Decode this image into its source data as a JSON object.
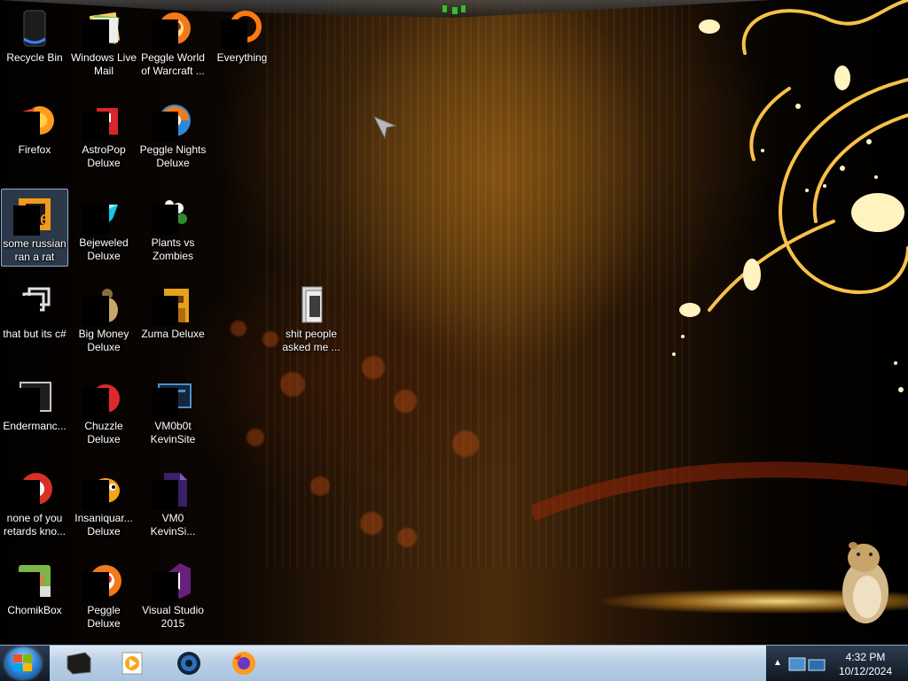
{
  "desktop_icons": [
    {
      "label": "Recycle Bin",
      "icon": "recycle-bin-icon",
      "selected": false
    },
    {
      "label": "Windows Live\nMail",
      "icon": "mail-icon",
      "selected": false
    },
    {
      "label": "Peggle World\nof Warcraft ...",
      "icon": "peggle-wow-icon",
      "selected": false
    },
    {
      "label": "Everything",
      "icon": "everything-search-icon",
      "selected": false
    },
    {
      "label": "Firefox",
      "icon": "firefox-icon",
      "selected": false
    },
    {
      "label": "AstroPop\nDeluxe",
      "icon": "astropop-icon",
      "selected": false
    },
    {
      "label": "Peggle Nights\nDeluxe",
      "icon": "peggle-nights-icon",
      "selected": false
    },
    {
      "label": "some russian\nran a rat",
      "icon": "app-icon",
      "selected": true
    },
    {
      "label": "Bejeweled\nDeluxe",
      "icon": "bejeweled-icon",
      "selected": false
    },
    {
      "label": "Plants vs\nZombies",
      "icon": "plants-vs-zombies-icon",
      "selected": false
    },
    {
      "label": "that but its c#",
      "icon": "shortcut-icon",
      "selected": false
    },
    {
      "label": "Big Money\nDeluxe",
      "icon": "big-money-icon",
      "selected": false
    },
    {
      "label": "Zuma Deluxe",
      "icon": "zuma-icon",
      "selected": false
    },
    {
      "label": "shit people\nasked me ...",
      "icon": "folder-icon",
      "selected": false
    },
    {
      "label": "Endermanc...",
      "icon": "terminal-icon",
      "selected": false
    },
    {
      "label": "Chuzzle\nDeluxe",
      "icon": "chuzzle-icon",
      "selected": false
    },
    {
      "label": "VM0b0t\nKevinSite",
      "icon": "vm-icon",
      "selected": false
    },
    {
      "label": "none of you\nretards kno...",
      "icon": "chrome-like-icon",
      "selected": false
    },
    {
      "label": "Insaniquar...\nDeluxe",
      "icon": "insaniquarium-icon",
      "selected": false
    },
    {
      "label": "VM0\nKevinSi...",
      "icon": "vm-doc-icon",
      "selected": false
    },
    {
      "label": "ChomikBox",
      "icon": "chomikbox-icon",
      "selected": false
    },
    {
      "label": "Peggle Deluxe",
      "icon": "peggle-icon",
      "selected": false
    },
    {
      "label": "Visual Studio\n2015",
      "icon": "visual-studio-icon",
      "selected": false
    }
  ],
  "taskbar": {
    "start_icon": "windows-logo-icon",
    "pinned": [
      {
        "icon": "terminal-app-icon"
      },
      {
        "icon": "media-player-icon"
      },
      {
        "icon": "globe-app-icon"
      },
      {
        "icon": "firefox-icon"
      }
    ],
    "tray_icons": [
      "show-hidden-arrow-icon",
      "network-icon"
    ],
    "clock": {
      "time": "4:32 PM",
      "date": "10/12/2024"
    }
  },
  "colors": {
    "taskbar": "#b9cfe6",
    "selection": "#78a0d2",
    "wallpaper_gold": "#f5b733"
  }
}
